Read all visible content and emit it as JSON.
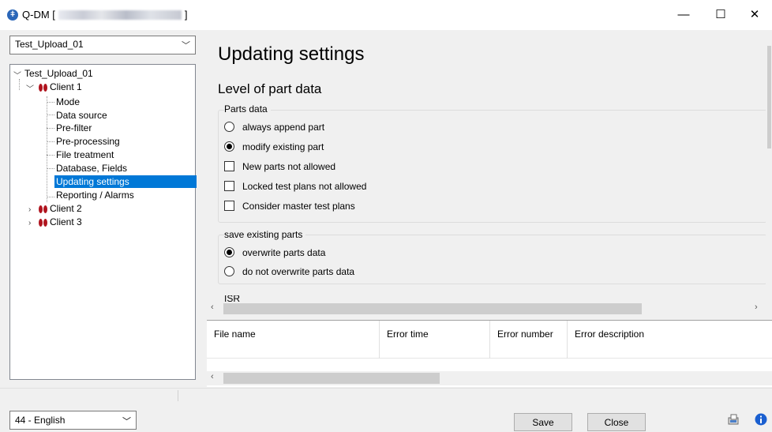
{
  "window": {
    "title_prefix": "Q-DM [",
    "title_suffix": "]",
    "minimize_glyph": "—",
    "maximize_glyph": "☐",
    "close_glyph": "✕"
  },
  "left": {
    "client_select_value": "Test_Upload_01",
    "tree": {
      "root": "Test_Upload_01",
      "client1": "Client 1",
      "children": [
        "Mode",
        "Data source",
        "Pre-filter",
        "Pre-processing",
        "File treatment",
        "Database, Fields",
        "Updating settings",
        "Reporting / Alarms"
      ],
      "client2": "Client 2",
      "client3": "Client 3"
    }
  },
  "main": {
    "page_title": "Updating settings",
    "section_title": "Level of part data",
    "parts_group": {
      "label": "Parts data",
      "options": [
        {
          "label": "always append part",
          "type": "radio",
          "checked": false
        },
        {
          "label": "modify existing part",
          "type": "radio",
          "checked": true
        },
        {
          "label": "New parts not allowed",
          "type": "checkbox",
          "checked": false
        },
        {
          "label": "Locked test plans not allowed",
          "type": "checkbox",
          "checked": false
        },
        {
          "label": "Consider master test plans",
          "type": "checkbox",
          "checked": false
        }
      ]
    },
    "save_group": {
      "label": "save existing parts",
      "options": [
        {
          "label": "overwrite parts data",
          "type": "radio",
          "checked": true
        },
        {
          "label": "do not overwrite parts data",
          "type": "radio",
          "checked": false
        }
      ]
    },
    "next_group_partial_label": "ISR"
  },
  "errors_table": {
    "columns": [
      "File name",
      "Error time",
      "Error number",
      "Error description"
    ]
  },
  "bottom": {
    "language_value": "44 - English",
    "save_label": "Save",
    "close_label": "Close"
  },
  "colors": {
    "selection": "#0078d7",
    "client_icon": "#b0141e",
    "info_icon": "#1a5fd0"
  }
}
